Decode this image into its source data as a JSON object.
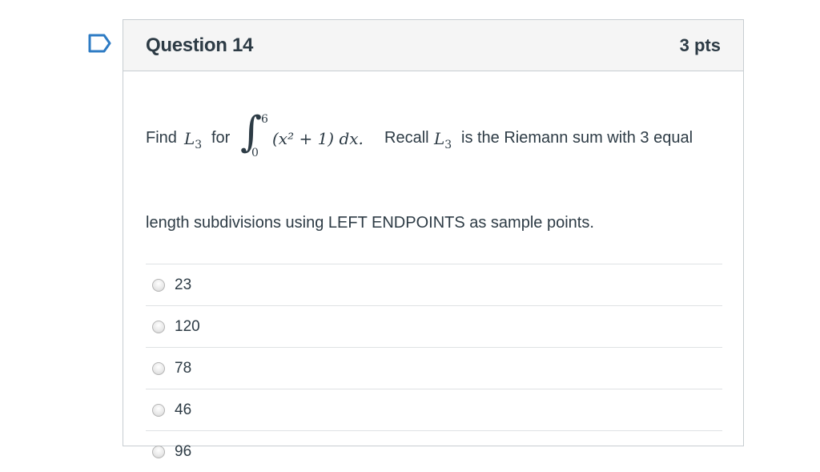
{
  "question": {
    "title": "Question 14",
    "points": "3 pts",
    "stem": {
      "find": "Find",
      "L": "L",
      "sub": "3",
      "for": "for",
      "upper": "6",
      "lower": "0",
      "integrand": "(x² + 1) dx.",
      "recall": "Recall",
      "tail": "is the Riemann sum with 3 equal",
      "line2": "length subdivisions using LEFT ENDPOINTS as sample points."
    },
    "answers": [
      {
        "label": "23"
      },
      {
        "label": "120"
      },
      {
        "label": "78"
      },
      {
        "label": "46"
      },
      {
        "label": "96"
      }
    ]
  },
  "colors": {
    "text": "#2d3b45",
    "border": "#c7cdd1",
    "header_bg": "#f5f5f5",
    "flag": "#2d7bc4"
  },
  "icons": {
    "flag": "bookmark-flag-icon"
  }
}
